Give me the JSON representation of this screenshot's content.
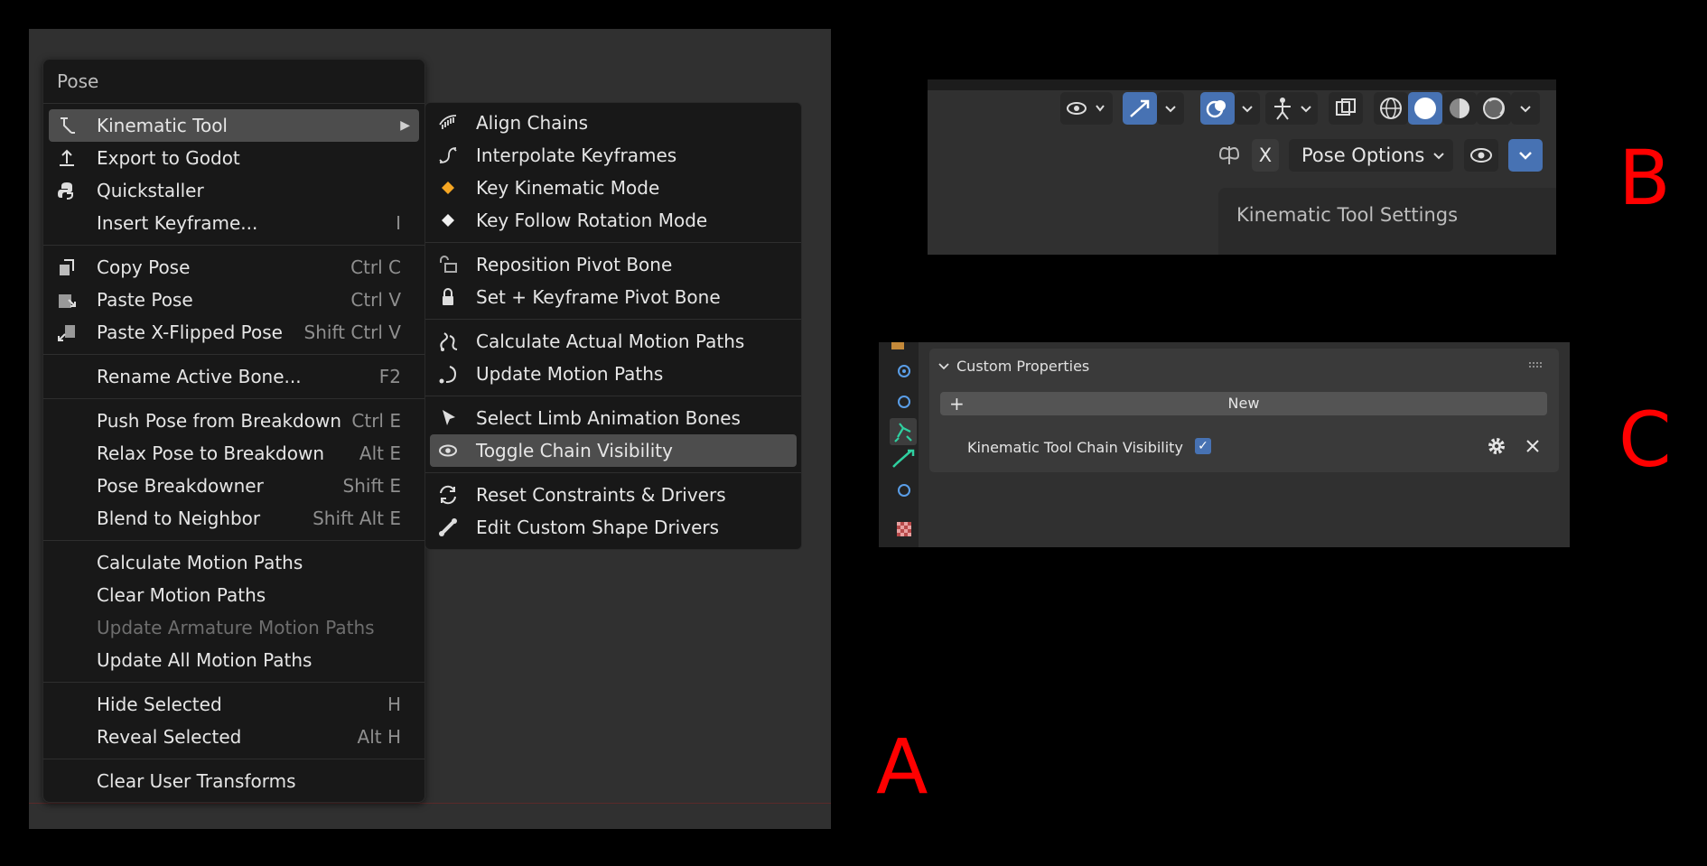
{
  "labels": {
    "a": "A",
    "b": "B",
    "c": "C"
  },
  "pose_menu": {
    "title": "Pose",
    "items": [
      {
        "label": "Kinematic Tool",
        "shortcut": "",
        "icon": "kinematic-icon",
        "active": true,
        "submenu": true
      },
      {
        "label": "Export to Godot",
        "shortcut": "",
        "icon": "export-icon"
      },
      {
        "label": "Quickstaller",
        "shortcut": "",
        "icon": "python-icon"
      },
      {
        "label": "Insert Keyframe...",
        "shortcut": "I",
        "icon": ""
      },
      {
        "sep": true
      },
      {
        "label": "Copy Pose",
        "shortcut": "Ctrl C",
        "icon": "copy-pose-icon"
      },
      {
        "label": "Paste Pose",
        "shortcut": "Ctrl V",
        "icon": "paste-pose-icon"
      },
      {
        "label": "Paste X-Flipped Pose",
        "shortcut": "Shift Ctrl V",
        "icon": "paste-flipped-icon"
      },
      {
        "sep": true
      },
      {
        "label": "Rename Active Bone...",
        "shortcut": "F2",
        "icon": ""
      },
      {
        "sep": true
      },
      {
        "label": "Push Pose from Breakdown",
        "shortcut": "Ctrl E",
        "icon": ""
      },
      {
        "label": "Relax Pose to Breakdown",
        "shortcut": "Alt E",
        "icon": ""
      },
      {
        "label": "Pose Breakdowner",
        "shortcut": "Shift E",
        "icon": ""
      },
      {
        "label": "Blend to Neighbor",
        "shortcut": "Shift Alt E",
        "icon": ""
      },
      {
        "sep": true
      },
      {
        "label": "Calculate Motion Paths",
        "shortcut": "",
        "icon": ""
      },
      {
        "label": "Clear Motion Paths",
        "shortcut": "",
        "icon": ""
      },
      {
        "label": "Update Armature Motion Paths",
        "shortcut": "",
        "icon": "",
        "disabled": true
      },
      {
        "label": "Update All Motion Paths",
        "shortcut": "",
        "icon": ""
      },
      {
        "sep": true
      },
      {
        "label": "Hide Selected",
        "shortcut": "H",
        "icon": ""
      },
      {
        "label": "Reveal Selected",
        "shortcut": "Alt H",
        "icon": ""
      },
      {
        "sep": true
      },
      {
        "label": "Clear User Transforms",
        "shortcut": "",
        "icon": ""
      }
    ]
  },
  "kinematic_submenu": {
    "items": [
      {
        "label": "Align Chains",
        "icon": "comb-icon"
      },
      {
        "label": "Interpolate Keyframes",
        "icon": "curve-icon"
      },
      {
        "label": "Key Kinematic Mode",
        "icon": "keyframe-orange-icon"
      },
      {
        "label": "Key Follow Rotation Mode",
        "icon": "keyframe-white-icon"
      },
      {
        "sep": true
      },
      {
        "label": "Reposition Pivot Bone",
        "icon": "pivot-lock-open-icon"
      },
      {
        "label": "Set + Keyframe Pivot Bone",
        "icon": "lock-icon"
      },
      {
        "sep": true
      },
      {
        "label": "Calculate Actual Motion Paths",
        "icon": "motion-path-icon"
      },
      {
        "label": "Update Motion Paths",
        "icon": "update-path-icon"
      },
      {
        "sep": true
      },
      {
        "label": "Select Limb Animation Bones",
        "icon": "cursor-icon"
      },
      {
        "label": "Toggle Chain Visibility",
        "icon": "eye-icon",
        "active": true
      },
      {
        "sep": true
      },
      {
        "label": "Reset Constraints & Drivers",
        "icon": "refresh-icon"
      },
      {
        "label": "Edit Custom Shape Drivers",
        "icon": "bone-icon"
      }
    ]
  },
  "header_b": {
    "mirror_label": "X",
    "pose_options": "Pose Options",
    "popover_title": "Kinematic Tool Settings"
  },
  "custom_props": {
    "title": "Custom Properties",
    "new_label": "New",
    "prop_name": "Kinematic Tool Chain Visibility",
    "prop_checked": true
  },
  "colors": {
    "accent": "#4772b3",
    "label_red": "#ff0000",
    "keyframe_orange": "#f5a623"
  }
}
